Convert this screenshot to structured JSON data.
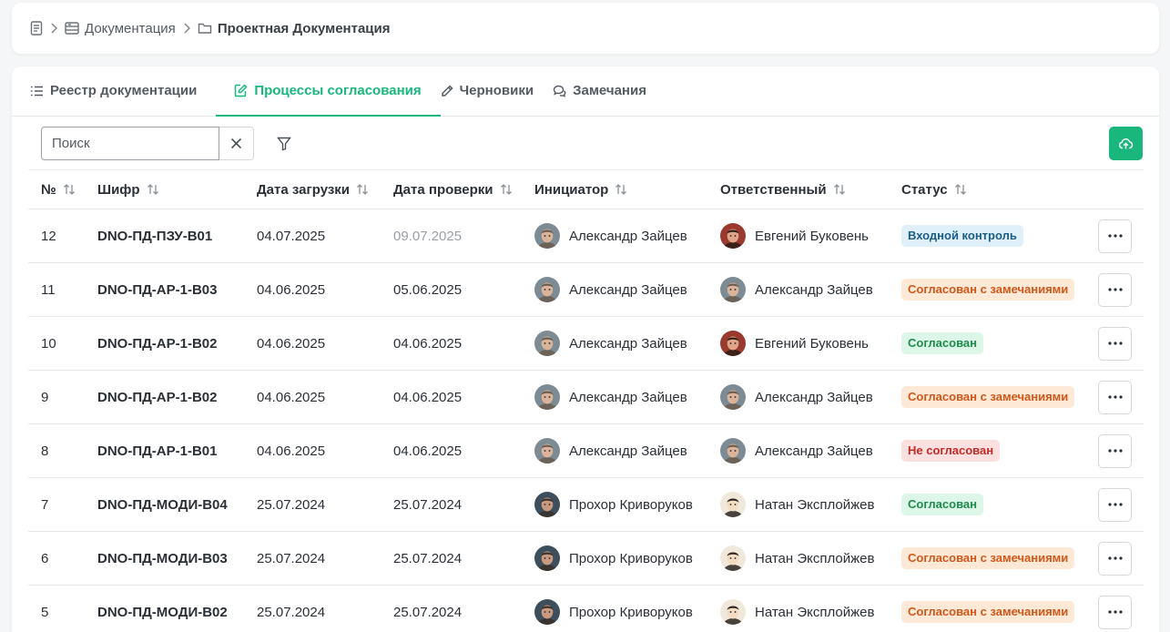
{
  "breadcrumb": {
    "items": [
      {
        "label": "Документация"
      },
      {
        "label": "Проектная Документация"
      }
    ]
  },
  "tabs": [
    {
      "label": "Реестр документации",
      "active": false
    },
    {
      "label": "Процессы согласования",
      "active": true
    },
    {
      "label": "Черновики",
      "active": false
    },
    {
      "label": "Замечания",
      "active": false
    }
  ],
  "toolbar": {
    "search_placeholder": "Поиск",
    "search_value": ""
  },
  "colors": {
    "accent": "#19b77c",
    "status_info": "#1b5d85",
    "status_warn": "#d2571a",
    "status_ok": "#1f8b4c",
    "status_err": "#c42a26"
  },
  "table": {
    "columns": [
      "№",
      "Шифр",
      "Дата загрузки",
      "Дата проверки",
      "Инициатор",
      "Ответственный",
      "Статус"
    ],
    "rows": [
      {
        "num": "12",
        "code": "DNO-ПД-ПЗУ-В01",
        "uploaded": "04.07.2025",
        "checked": "09.07.2025",
        "checked_muted": true,
        "initiator": "Александр Зайцев",
        "responsible": "Евгений Буковень",
        "status": "Входной контроль",
        "status_type": "info"
      },
      {
        "num": "11",
        "code": "DNO-ПД-АР-1-В03",
        "uploaded": "04.06.2025",
        "checked": "05.06.2025",
        "checked_muted": false,
        "initiator": "Александр Зайцев",
        "responsible": "Александр Зайцев",
        "status": "Согласован с замечаниями",
        "status_type": "warn"
      },
      {
        "num": "10",
        "code": "DNO-ПД-АР-1-В02",
        "uploaded": "04.06.2025",
        "checked": "04.06.2025",
        "checked_muted": false,
        "initiator": "Александр Зайцев",
        "responsible": "Евгений Буковень",
        "status": "Согласован",
        "status_type": "ok"
      },
      {
        "num": "9",
        "code": "DNO-ПД-АР-1-В02",
        "uploaded": "04.06.2025",
        "checked": "04.06.2025",
        "checked_muted": false,
        "initiator": "Александр Зайцев",
        "responsible": "Александр Зайцев",
        "status": "Согласован с замечаниями",
        "status_type": "warn"
      },
      {
        "num": "8",
        "code": "DNO-ПД-АР-1-В01",
        "uploaded": "04.06.2025",
        "checked": "04.06.2025",
        "checked_muted": false,
        "initiator": "Александр Зайцев",
        "responsible": "Александр Зайцев",
        "status": "Не согласован",
        "status_type": "err"
      },
      {
        "num": "7",
        "code": "DNO-ПД-МОДИ-В04",
        "uploaded": "25.07.2024",
        "checked": "25.07.2024",
        "checked_muted": false,
        "initiator": "Прохор Криворуков",
        "responsible": "Натан Эксплойжев",
        "status": "Согласован",
        "status_type": "ok"
      },
      {
        "num": "6",
        "code": "DNO-ПД-МОДИ-В03",
        "uploaded": "25.07.2024",
        "checked": "25.07.2024",
        "checked_muted": false,
        "initiator": "Прохор Криворуков",
        "responsible": "Натан Эксплойжев",
        "status": "Согласован с замечаниями",
        "status_type": "warn"
      },
      {
        "num": "5",
        "code": "DNO-ПД-МОДИ-В02",
        "uploaded": "25.07.2024",
        "checked": "25.07.2024",
        "checked_muted": false,
        "initiator": "Прохор Криворуков",
        "responsible": "Натан Эксплойжев",
        "status": "Согласован с замечаниями",
        "status_type": "warn"
      }
    ]
  }
}
